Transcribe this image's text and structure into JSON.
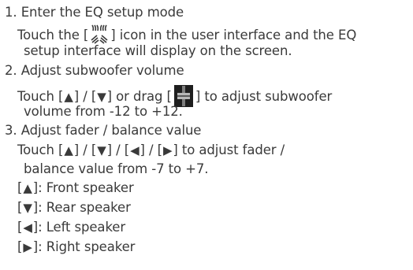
{
  "steps": [
    {
      "title": "1. Enter the EQ setup mode",
      "body": {
        "pre": "Touch the [",
        "icon": "eq-setup-icon",
        "post": "] icon in the user interface and the EQ",
        "cont": "setup interface will display on the screen."
      }
    },
    {
      "title": "2. Adjust subwoofer volume",
      "body": {
        "seg1": "Touch [",
        "seg2": "] / [",
        "seg3": "] or drag [",
        "seg4": "] to adjust subwoofer",
        "cont": "volume from -12 to +12."
      }
    },
    {
      "title": "3. Adjust fader / balance value",
      "body": {
        "seg1": "Touch [",
        "seg2": "] / [",
        "seg3": "] / [",
        "seg4": "] / [",
        "seg5": "]  to adjust  fader /",
        "cont": "balance value from -7 to +7."
      },
      "legend": [
        {
          "open": "[",
          "close": "]: Front speaker",
          "icon": "triangle-up-icon"
        },
        {
          "open": "[",
          "close": "]: Rear speaker",
          "icon": "triangle-down-icon"
        },
        {
          "open": "[",
          "close": "]: Left speaker",
          "icon": "triangle-left-icon"
        },
        {
          "open": "[",
          "close": "]: Right speaker",
          "icon": "triangle-right-icon"
        }
      ]
    }
  ],
  "glyphs": {
    "up": "▲",
    "down": "▼",
    "left": "◀",
    "right": "▶"
  },
  "icons": {
    "eq": "eq-setup-icon",
    "fader": "fader-slider-icon"
  },
  "colors": {
    "text": "#3a3a3a",
    "icon_dark": "#222222",
    "icon_light": "#9a9a9a"
  }
}
